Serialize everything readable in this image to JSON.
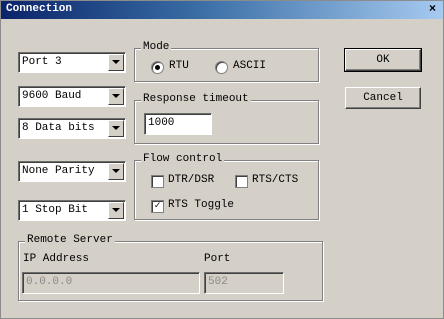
{
  "window": {
    "title": "Connection",
    "close_glyph": "×"
  },
  "combos": {
    "port": "Port 3",
    "baud": "9600 Baud",
    "data_bits": "8 Data bits",
    "parity": "None Parity",
    "stop_bits": "1 Stop Bit"
  },
  "mode": {
    "label": "Mode",
    "rtu": "RTU",
    "ascii": "ASCII",
    "selected": "RTU"
  },
  "response": {
    "label": "Response timeout",
    "value": "1000"
  },
  "flow": {
    "label": "Flow control",
    "dtr_dsr": "DTR/DSR",
    "rts_cts": "RTS/CTS",
    "rts_toggle": "RTS Toggle",
    "check_glyph": "✓"
  },
  "remote": {
    "label": "Remote Server",
    "ip_label": "IP Address",
    "port_label": "Port",
    "ip_value": "0.0.0.0",
    "port_value": "502"
  },
  "buttons": {
    "ok": "OK",
    "cancel": "Cancel"
  }
}
